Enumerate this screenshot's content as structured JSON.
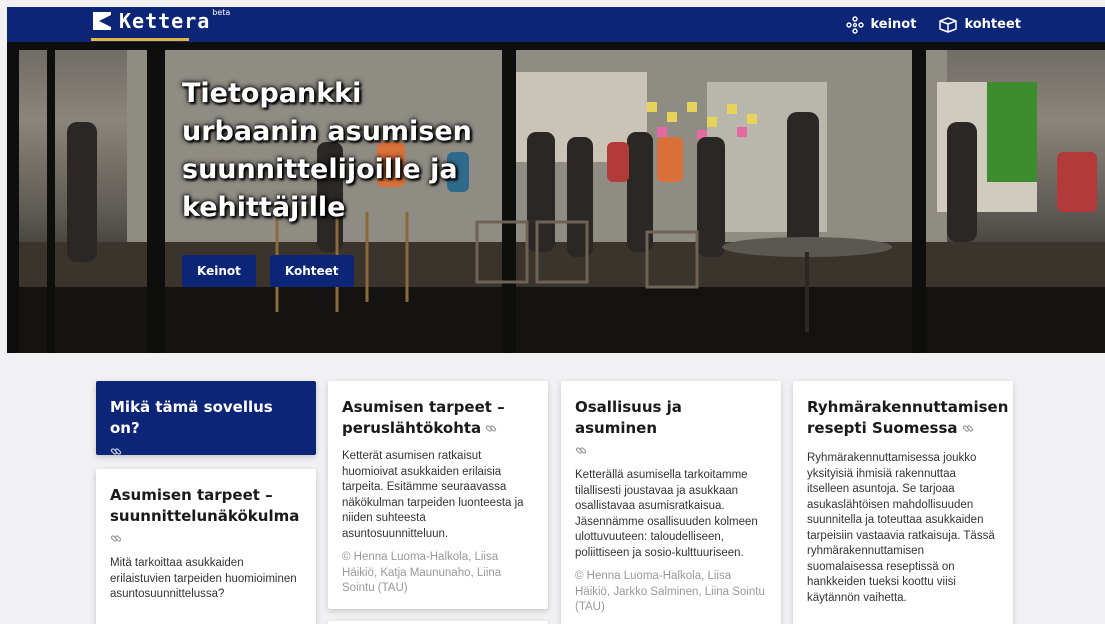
{
  "header": {
    "logo_text": "Kettera",
    "logo_badge": "beta",
    "nav": [
      {
        "label": "keinot",
        "icon": "molecule-icon"
      },
      {
        "label": "kohteet",
        "icon": "box-icon"
      }
    ]
  },
  "hero": {
    "title": "Tietopankki urbaanin asumisen suunnittelijoille ja kehittäjille",
    "buttons": [
      "Keinot",
      "Kohteet"
    ]
  },
  "cards": [
    {
      "title": "Mikä tämä sovellus on?",
      "icon": "link-icon"
    },
    {
      "title": "Asumisen tarpeet – suunnittelunäkökulma",
      "text": "Mitä tarkoittaa asukkaiden erilaistuvien tarpeiden huomioiminen asuntosuunnittelussa?",
      "icon": "link-icon"
    },
    {
      "title": "Asumisen tarpeet – peruslähtökohta",
      "text": "Ketterät asumisen ratkaisut huomioivat asukkaiden erilaisia tarpeita. Esitämme seuraavassa näkökulman tarpeiden luonteesta ja niiden suhteesta asuntosuunnitteluun.",
      "credit": "© Henna Luoma-Halkola, Liisa Häikiö, Katja Maununaho, Liina Sointu (TAU)",
      "icon": "link-icon"
    },
    {
      "title": "Osallisuus ja asuminen",
      "text": "Ketterällä asumisella tarkoitamme tilallisesti joustavaa ja asukkaan osallistavaa asumisratkaisua. Jäsennämme osallisuuden kolmeen ulottuvuuteen: taloudelliseen, poliittiseen ja sosio-kulttuuriseen.",
      "credit": "© Henna Luoma-Halkola, Liisa Häikiö, Jarkko Salminen, Liina Sointu (TAU)",
      "icon": "link-icon"
    },
    {
      "title": "Ryhmärakennuttamisen resepti Suomessa",
      "text": "Ryhmärakennuttamisessa joukko yksityisiä ihmisiä rakennuttaa itselleen asuntoja. Se tarjoaa asukaslähtöisen mahdollisuuden suunnitella ja toteuttaa asukkaiden tarpeisiin vastaavia ratkaisuja. Tässä ryhmärakennuttamisen suomalaisessa reseptissä on hankkeiden tueksi koottu viisi käytännön vaihetta.",
      "icon": "link-icon"
    }
  ],
  "colors": {
    "navy": "#0c2576",
    "accent": "#e3b53a",
    "page_bg": "#f1f1f3"
  }
}
